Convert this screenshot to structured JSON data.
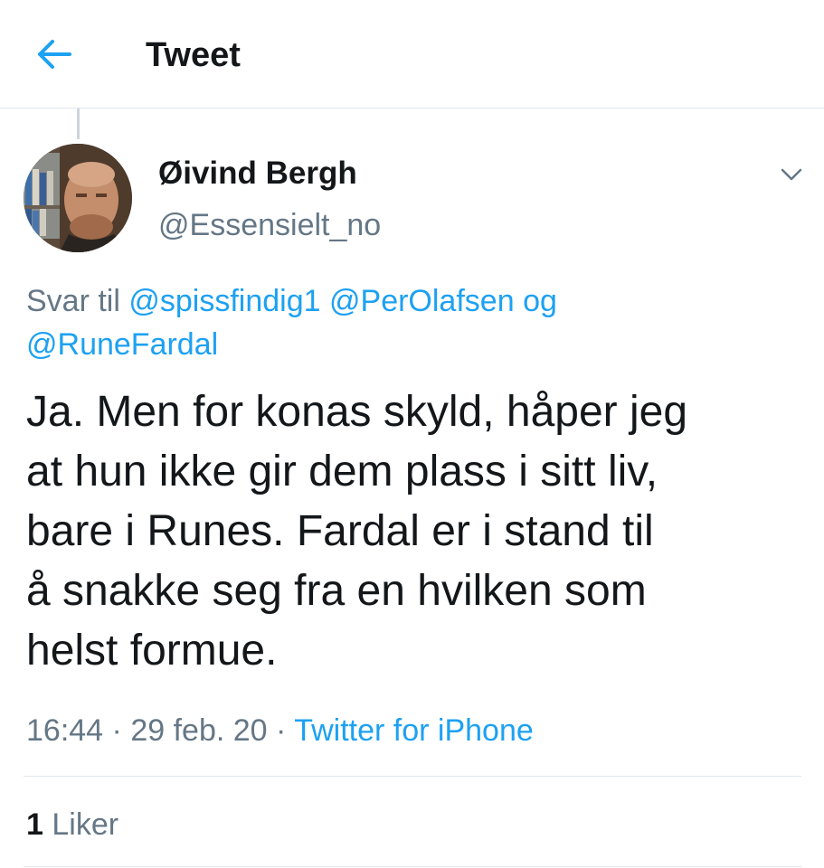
{
  "header": {
    "title": "Tweet",
    "back_icon": "arrow-left-icon"
  },
  "colors": {
    "accent": "#1da1f2",
    "text_primary": "#14171a",
    "text_secondary": "#657786",
    "divider": "#e1e8ed"
  },
  "tweet": {
    "author": {
      "display_name": "Øivind Bergh",
      "handle": "@Essensielt_no"
    },
    "menu_icon": "chevron-down-icon",
    "reply_to": {
      "prefix": "Svar til",
      "mentions": [
        "@spissfindig1",
        "@PerOlafsen"
      ],
      "conjunction": "og",
      "last_mention": "@RuneFardal"
    },
    "text": "Ja. Men for konas skyld, håper jeg\nat hun ikke gir dem plass i sitt liv,\nbare i Runes. Fardal er i stand til\nå snakke seg fra en hvilken som\nhelst formue.",
    "time": "16:44",
    "date": "29 feb. 20",
    "separator": "·",
    "source": "Twitter for iPhone",
    "likes": {
      "count": "1",
      "label": "Liker"
    }
  }
}
